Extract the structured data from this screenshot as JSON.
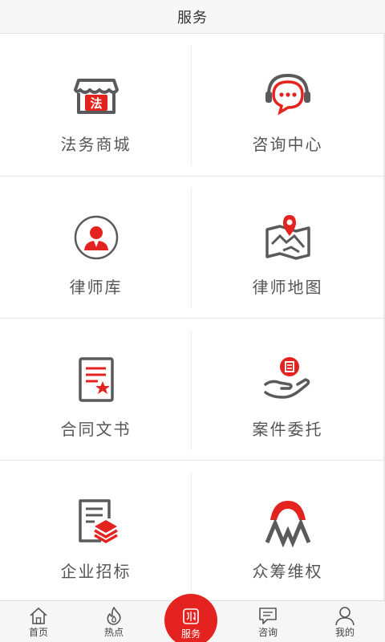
{
  "header": {
    "title": "服务"
  },
  "services": [
    {
      "label": "法务商城",
      "icon": "legal-store-icon",
      "badge": "法"
    },
    {
      "label": "咨询中心",
      "icon": "consult-headset-icon"
    },
    {
      "label": "律师库",
      "icon": "lawyer-avatar-icon"
    },
    {
      "label": "律师地图",
      "icon": "map-pin-icon"
    },
    {
      "label": "合同文书",
      "icon": "contract-document-icon"
    },
    {
      "label": "案件委托",
      "icon": "case-entrust-icon"
    },
    {
      "label": "企业招标",
      "icon": "bidding-document-icon"
    },
    {
      "label": "众筹维权",
      "icon": "crowdfunding-icon"
    }
  ],
  "tabs": [
    {
      "label": "首页",
      "icon": "home-icon"
    },
    {
      "label": "热点",
      "icon": "flame-icon"
    },
    {
      "label": "服务",
      "icon": "service-book-icon",
      "active": true
    },
    {
      "label": "咨询",
      "icon": "chat-icon"
    },
    {
      "label": "我的",
      "icon": "user-icon"
    }
  ],
  "colors": {
    "accent": "#e42320",
    "icon_gray": "#5a5a5a",
    "text": "#555555"
  }
}
